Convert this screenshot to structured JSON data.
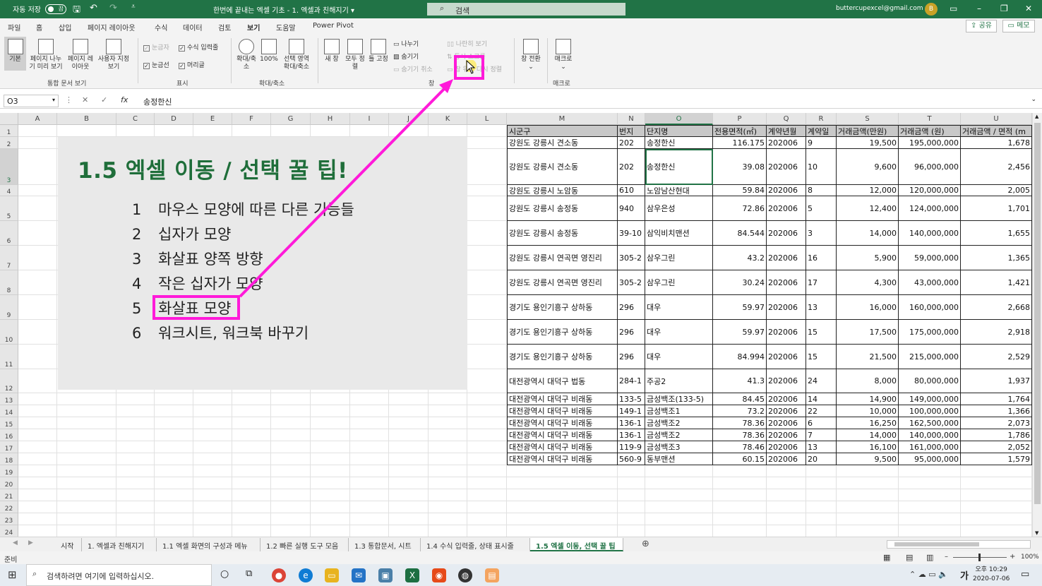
{
  "titlebar": {
    "autosave": "자동 저장",
    "autosave_state": "끔",
    "title": "한번에 끝내는 엑셀 기초 - 1. 엑셀과 친해지기 ▾",
    "search_placeholder": "검색",
    "account": "buttercupexcel@gmail.com",
    "avatar": "B"
  },
  "menu": [
    "파일",
    "홈",
    "삽입",
    "페이지 레이아웃",
    "수식",
    "데이터",
    "검토",
    "보기",
    "도움말",
    "Power Pivot"
  ],
  "share_label": "공유",
  "memo_label": "메모",
  "ribbon": {
    "view_normal": "기본",
    "view_pagebreak": "페이지 나누기 미리 보기",
    "view_pagelayout": "페이지 레이아웃",
    "view_custom": "사용자 지정 보기",
    "group_views": "통합 문서 보기",
    "ruler": "눈금자",
    "formulabar": "수식 입력줄",
    "gridlines": "눈금선",
    "headings": "머리글",
    "group_show": "표시",
    "zoom": "확대/축소",
    "zoom100": "100%",
    "zoom_selection": "선택 영역 확대/축소",
    "group_zoom": "확대/축소",
    "new_window": "새 창",
    "arrange_all": "모두 정렬",
    "freeze": "틀 고정",
    "split": "나누기",
    "hide": "숨기기",
    "unhide": "숨기기 취소",
    "side_by_side": "나란히 보기",
    "sync_scroll": "동시 스크롤",
    "reset_pos": "창 위치 다시 정렬",
    "group_window": "창",
    "switch_windows": "창 전환",
    "macros": "매크로",
    "group_macros": "매크로"
  },
  "formula_bar": {
    "name_box": "O3",
    "content": "송정한신"
  },
  "columns_left": [
    "A",
    "B",
    "C",
    "D",
    "E",
    "F",
    "G",
    "H",
    "I",
    "J",
    "K",
    "L"
  ],
  "columns_right": [
    "M",
    "N",
    "O",
    "P",
    "Q",
    "R",
    "S",
    "T",
    "U"
  ],
  "rows": [
    "1",
    "2",
    "3",
    "4",
    "5",
    "6",
    "7",
    "8",
    "9",
    "10",
    "11",
    "12",
    "13",
    "14",
    "15",
    "16",
    "17",
    "18",
    "19",
    "20",
    "21",
    "22",
    "23",
    "24"
  ],
  "slide": {
    "title": "1.5 엑셀 이동 / 선택 꿀 팁!",
    "tips": [
      {
        "num": "1",
        "text": "마우스 모양에 따른 다른 기능들"
      },
      {
        "num": "2",
        "text": "십자가 모양"
      },
      {
        "num": "3",
        "text": "화살표 양쪽 방향"
      },
      {
        "num": "4",
        "text": "작은 십자가 모양"
      },
      {
        "num": "5",
        "text": "화살표 모양"
      },
      {
        "num": "6",
        "text": "워크시트, 워크북 바꾸기"
      }
    ]
  },
  "table": {
    "headers": [
      "시군구",
      "번지",
      "단지명",
      "전용면적(㎡)",
      "계약년월",
      "계약일",
      "거래금액(만원)",
      "거래금액 (원)",
      "거래금액 / 면적 (m"
    ],
    "rows": [
      [
        "강원도 강릉시 견소동",
        "202",
        "송정한신",
        "116.175",
        "202006",
        "9",
        "19,500",
        "195,000,000",
        "1,678"
      ],
      [
        "강원도 강릉시 견소동",
        "202",
        "송정한신",
        "39.08",
        "202006",
        "10",
        "9,600",
        "96,000,000",
        "2,456"
      ],
      [
        "강원도 강릉시 노암동",
        "610",
        "노암남산현대",
        "59.84",
        "202006",
        "8",
        "12,000",
        "120,000,000",
        "2,005"
      ],
      [
        "강원도 강릉시 송정동",
        "940",
        "삼우은성",
        "72.86",
        "202006",
        "5",
        "12,400",
        "124,000,000",
        "1,701"
      ],
      [
        "강원도 강릉시 송정동",
        "39-10",
        "삼익비치맨션",
        "84.544",
        "202006",
        "3",
        "14,000",
        "140,000,000",
        "1,655"
      ],
      [
        "강원도 강릉시 연곡면 영진리",
        "305-2",
        "삼우그린",
        "43.2",
        "202006",
        "16",
        "5,900",
        "59,000,000",
        "1,365"
      ],
      [
        "강원도 강릉시 연곡면 영진리",
        "305-2",
        "삼우그린",
        "30.24",
        "202006",
        "17",
        "4,300",
        "43,000,000",
        "1,421"
      ],
      [
        "경기도 용인기흥구 상하동",
        "296",
        "대우",
        "59.97",
        "202006",
        "13",
        "16,000",
        "160,000,000",
        "2,668"
      ],
      [
        "경기도 용인기흥구 상하동",
        "296",
        "대우",
        "59.97",
        "202006",
        "15",
        "17,500",
        "175,000,000",
        "2,918"
      ],
      [
        "경기도 용인기흥구 상하동",
        "296",
        "대우",
        "84.994",
        "202006",
        "15",
        "21,500",
        "215,000,000",
        "2,529"
      ],
      [
        "대전광역시 대덕구 법동",
        "284-1",
        "주공2",
        "41.3",
        "202006",
        "24",
        "8,000",
        "80,000,000",
        "1,937"
      ],
      [
        "대전광역시 대덕구 비래동",
        "133-5",
        "금성백조(133-5)",
        "84.45",
        "202006",
        "14",
        "14,900",
        "149,000,000",
        "1,764"
      ],
      [
        "대전광역시 대덕구 비래동",
        "149-1",
        "금성백조1",
        "73.2",
        "202006",
        "22",
        "10,000",
        "100,000,000",
        "1,366"
      ],
      [
        "대전광역시 대덕구 비래동",
        "136-1",
        "금성백조2",
        "78.36",
        "202006",
        "6",
        "16,250",
        "162,500,000",
        "2,073"
      ],
      [
        "대전광역시 대덕구 비래동",
        "136-1",
        "금성백조2",
        "78.36",
        "202006",
        "7",
        "14,000",
        "140,000,000",
        "1,786"
      ],
      [
        "대전광역시 대덕구 비래동",
        "119-9",
        "금성백조3",
        "78.46",
        "202006",
        "13",
        "16,100",
        "161,000,000",
        "2,052"
      ],
      [
        "대전광역시 대덕구 비래동",
        "560-9",
        "동부맨션",
        "60.15",
        "202006",
        "20",
        "9,500",
        "95,000,000",
        "1,579"
      ]
    ]
  },
  "tabs": [
    "시작",
    "1. 엑셀과 친해지기",
    "1.1 엑셀 화면의 구성과 메뉴",
    "1.2 빠른 실행 도구 모음",
    "1.3 통합문서, 시트",
    "1.4 수식 입력줄, 상태 표시줄",
    "1.5 엑셀 이동, 선택 꿀 팁"
  ],
  "status": {
    "ready": "준비",
    "zoom": "100%"
  },
  "taskbar": {
    "search": "검색하려면 여기에 입력하십시오.",
    "time": "오후 10:29",
    "date": "2020-07-06",
    "ime": "가"
  },
  "colors": {
    "excel_green": "#217346",
    "highlight_magenta": "#ff1ad9",
    "slide_title": "#1f6e3a"
  },
  "icons": [
    "save-icon",
    "undo-icon",
    "redo-icon",
    "search-icon",
    "normal-view-icon",
    "page-break-icon",
    "page-layout-icon",
    "custom-view-icon",
    "zoom-icon",
    "new-window-icon",
    "arrange-icon",
    "freeze-icon",
    "switch-window-icon",
    "macro-icon",
    "windows-start-icon",
    "chrome-icon",
    "edge-icon",
    "folder-icon",
    "mail-icon",
    "excel-icon",
    "cursor-icon"
  ]
}
